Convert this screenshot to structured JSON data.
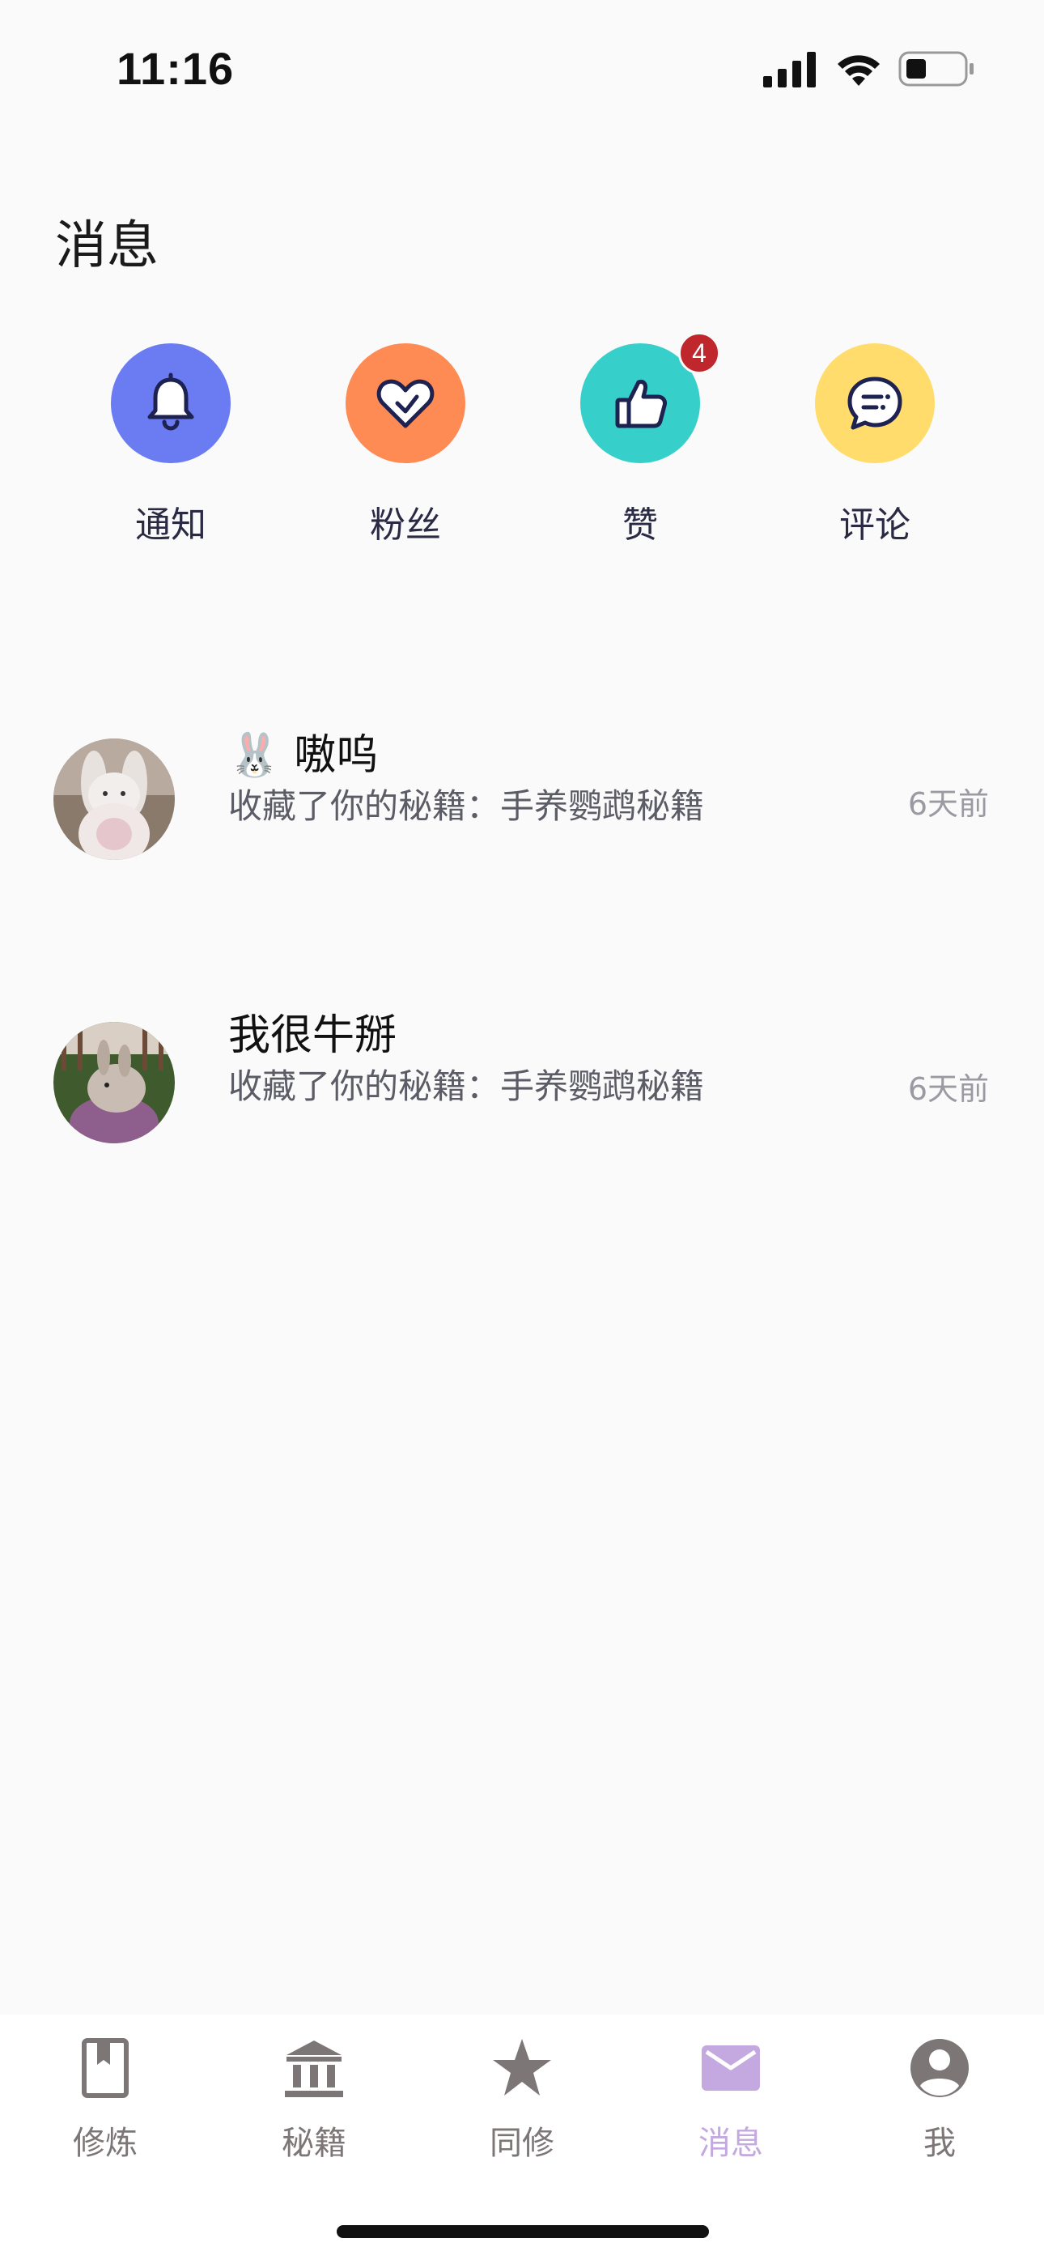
{
  "status": {
    "time": "11:16"
  },
  "header": {
    "title": "消息"
  },
  "quick_actions": [
    {
      "label": "通知",
      "icon": "bell-icon",
      "color": "#6b7cf2"
    },
    {
      "label": "粉丝",
      "icon": "heart-icon",
      "color": "#fe8a54"
    },
    {
      "label": "赞",
      "icon": "thumbs-up-icon",
      "color": "#36cfc9",
      "badge": "4"
    },
    {
      "label": "评论",
      "icon": "comment-icon",
      "color": "#ffdc6b"
    }
  ],
  "messages": [
    {
      "name_emoji": "🐰",
      "name": "嗷呜",
      "text": "收藏了你的秘籍：手养鹦鹉秘籍",
      "time": "6天前"
    },
    {
      "name": "我很牛掰",
      "text": "收藏了你的秘籍：手养鹦鹉秘籍",
      "time": "6天前"
    }
  ],
  "tabbar": {
    "items": [
      {
        "label": "修炼",
        "icon": "book-icon"
      },
      {
        "label": "秘籍",
        "icon": "bank-icon"
      },
      {
        "label": "同修",
        "icon": "star-icon"
      },
      {
        "label": "消息",
        "icon": "mail-icon",
        "active": true
      },
      {
        "label": "我",
        "icon": "account-icon"
      }
    ],
    "active_color": "#c3a9e0",
    "inactive_color": "#7d7676"
  }
}
